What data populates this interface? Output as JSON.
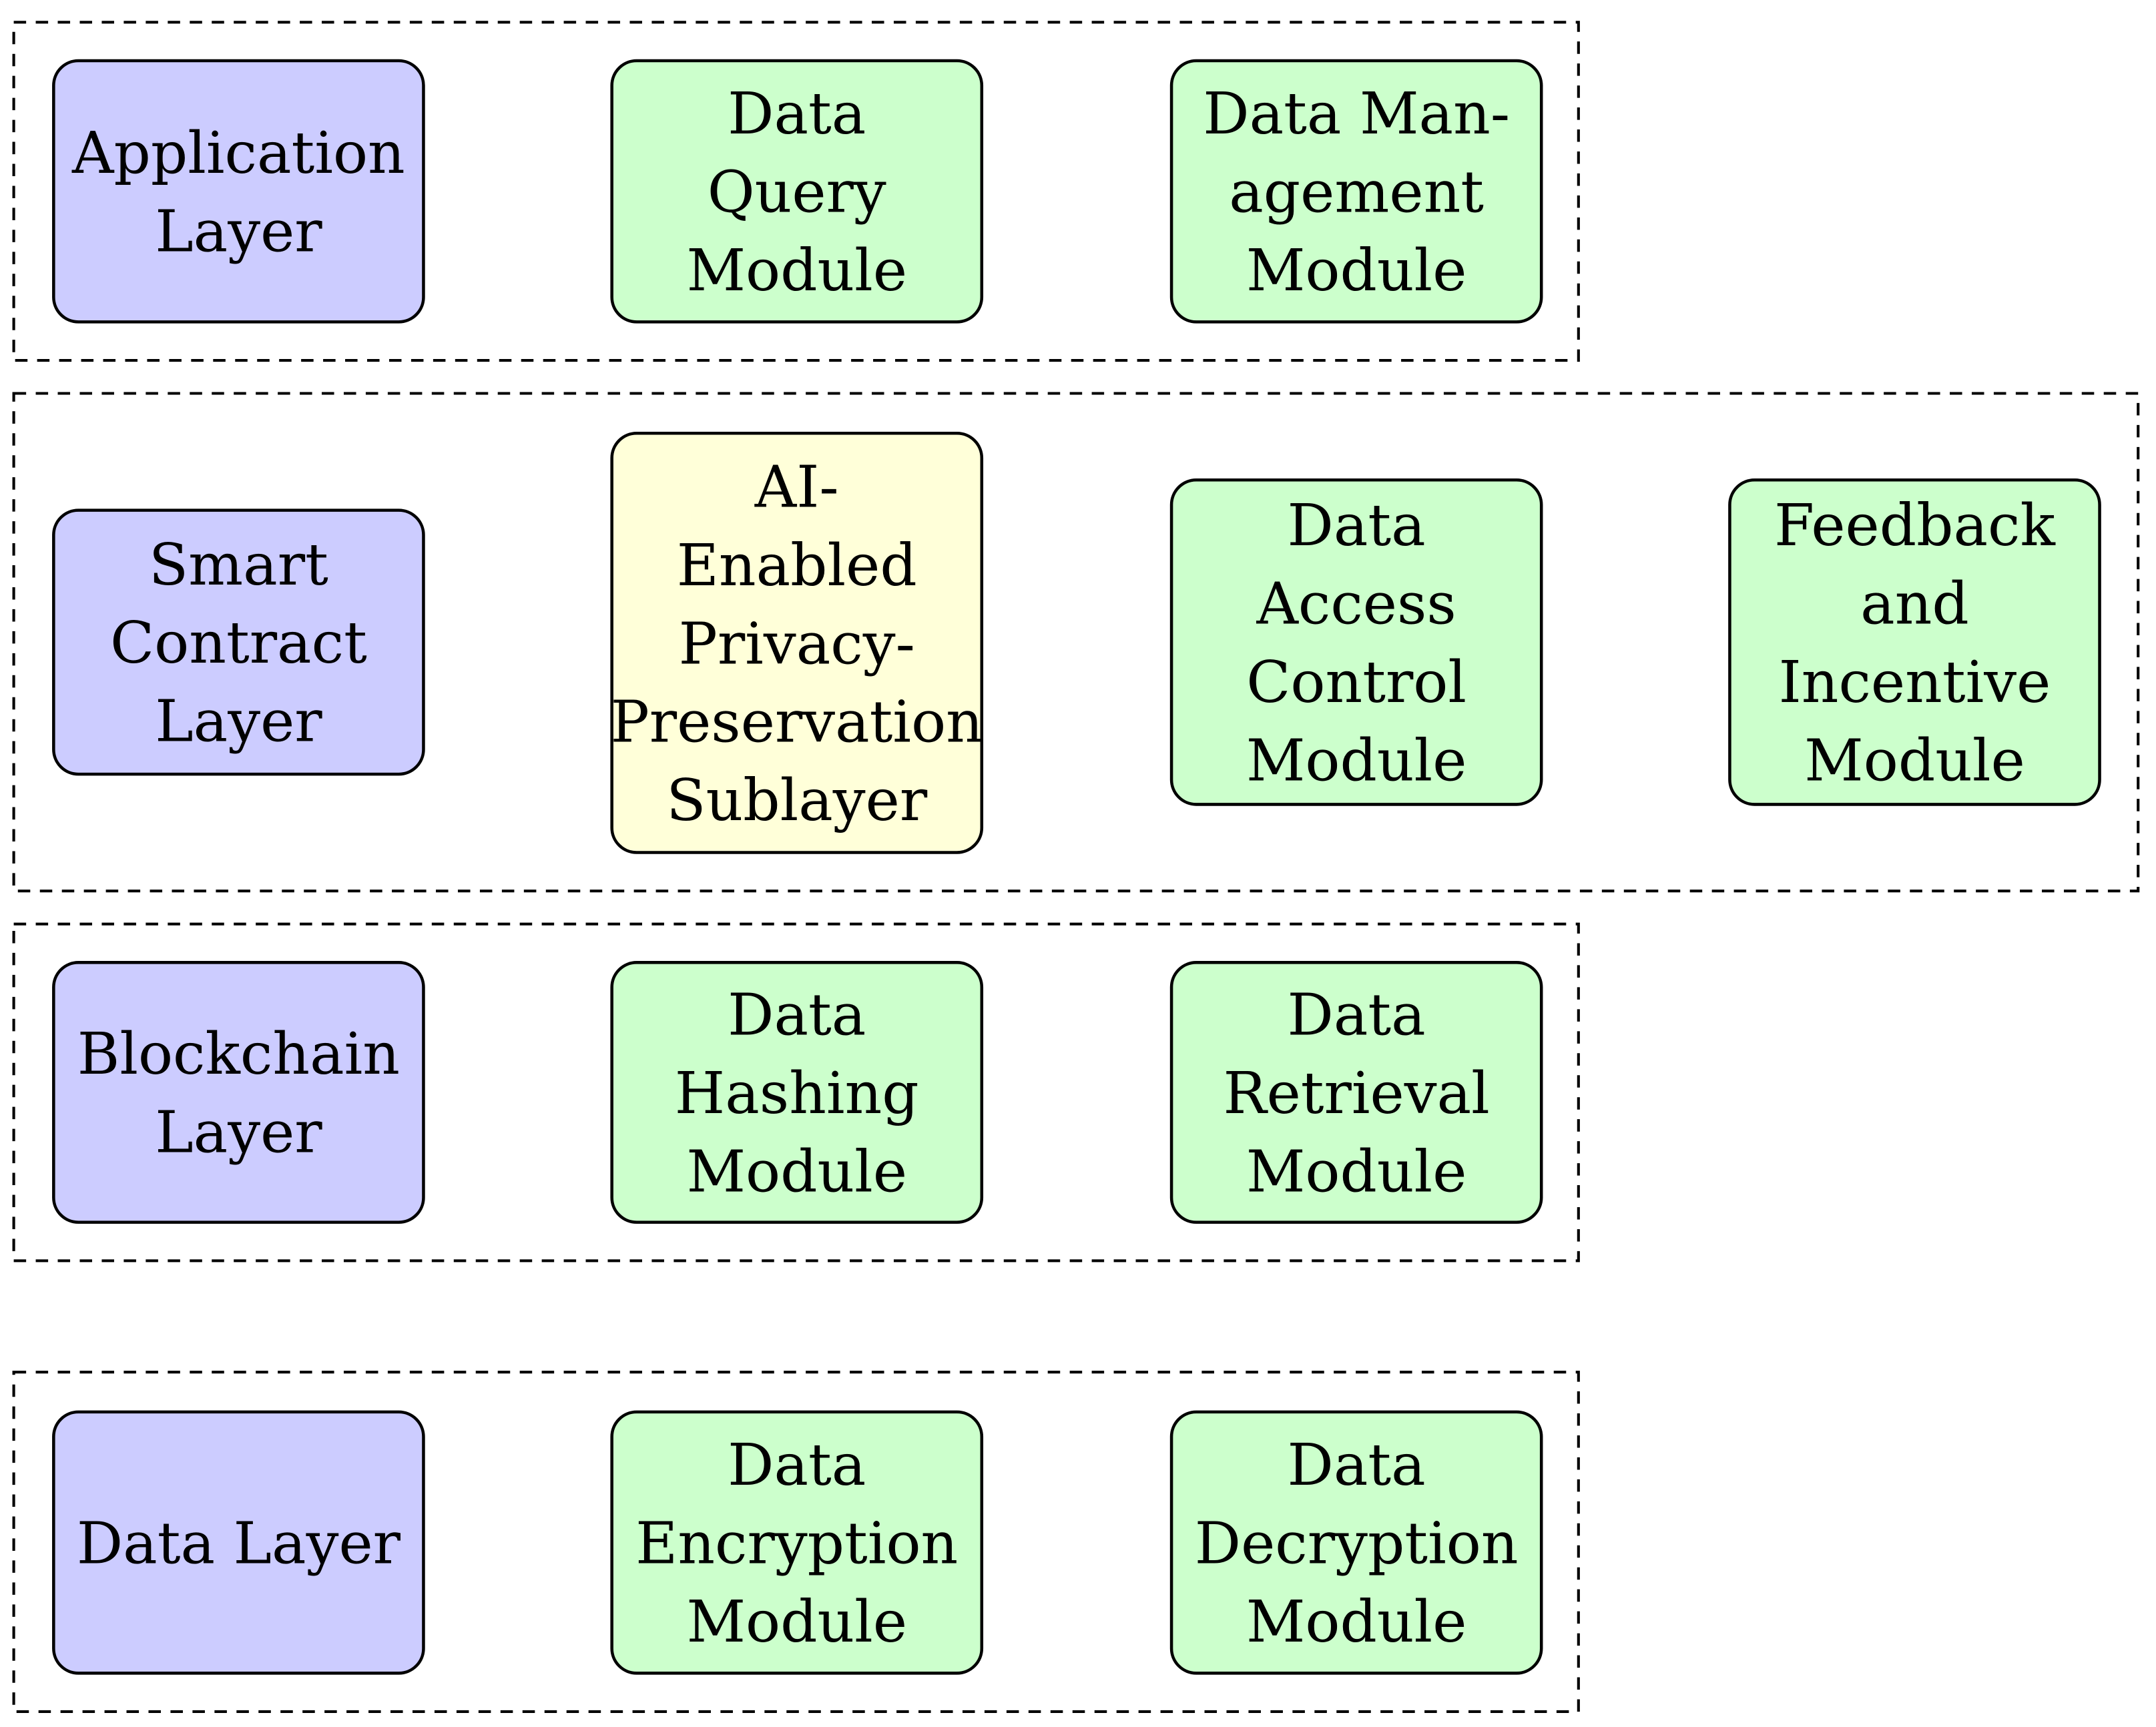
{
  "colors": {
    "layer": "#ccccff",
    "module": "#ccffcc",
    "sublayer": "#ffffd9",
    "stroke": "#000000"
  },
  "layers": [
    {
      "nodes": [
        {
          "kind": "layer",
          "lines": [
            "Application",
            "Layer"
          ]
        },
        {
          "kind": "module",
          "lines": [
            "Data",
            "Query",
            "Module"
          ]
        },
        {
          "kind": "module",
          "lines": [
            "Data Man-",
            "agement",
            "Module"
          ]
        }
      ]
    },
    {
      "nodes": [
        {
          "kind": "layer",
          "lines": [
            "Smart",
            "Contract",
            "Layer"
          ]
        },
        {
          "kind": "sublayer",
          "lines": [
            "AI-",
            "Enabled",
            "Privacy-",
            "Preservation",
            "Sublayer"
          ]
        },
        {
          "kind": "module",
          "lines": [
            "Data",
            "Access",
            "Control",
            "Module"
          ]
        },
        {
          "kind": "module",
          "lines": [
            "Feedback",
            "and",
            "Incentive",
            "Module"
          ]
        }
      ]
    },
    {
      "nodes": [
        {
          "kind": "layer",
          "lines": [
            "Blockchain",
            "Layer"
          ]
        },
        {
          "kind": "module",
          "lines": [
            "Data",
            "Hashing",
            "Module"
          ]
        },
        {
          "kind": "module",
          "lines": [
            "Data",
            "Retrieval",
            "Module"
          ]
        }
      ]
    },
    {
      "nodes": [
        {
          "kind": "layer",
          "lines": [
            "Data Layer"
          ]
        },
        {
          "kind": "module",
          "lines": [
            "Data",
            "Encryption",
            "Module"
          ]
        },
        {
          "kind": "module",
          "lines": [
            "Data",
            "Decryption",
            "Module"
          ]
        }
      ]
    }
  ]
}
